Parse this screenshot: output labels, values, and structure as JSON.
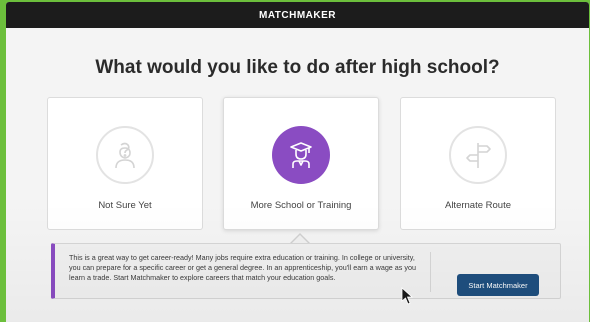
{
  "app": {
    "title": "MATCHMAKER"
  },
  "page": {
    "question": "What would you like to do after high school?"
  },
  "options": [
    {
      "label": "Not Sure Yet",
      "icon": "person-question-icon",
      "selected": false
    },
    {
      "label": "More School or Training",
      "icon": "graduate-icon",
      "selected": true
    },
    {
      "label": "Alternate Route",
      "icon": "signpost-icon",
      "selected": false
    }
  ],
  "info": {
    "text": "This is a great way to get career-ready! Many jobs require extra education or training. In college or university, you can prepare for a specific career or get a general degree. In an apprenticeship, you'll earn a wage as you learn a trade. Start Matchmaker to explore careers that match your education goals.",
    "button_label": "Start Matchmaker"
  },
  "colors": {
    "accent": "#8a4cc2",
    "button": "#1f4f7f",
    "topbar": "#1c1c1c",
    "background_border": "#6cbf3c"
  }
}
